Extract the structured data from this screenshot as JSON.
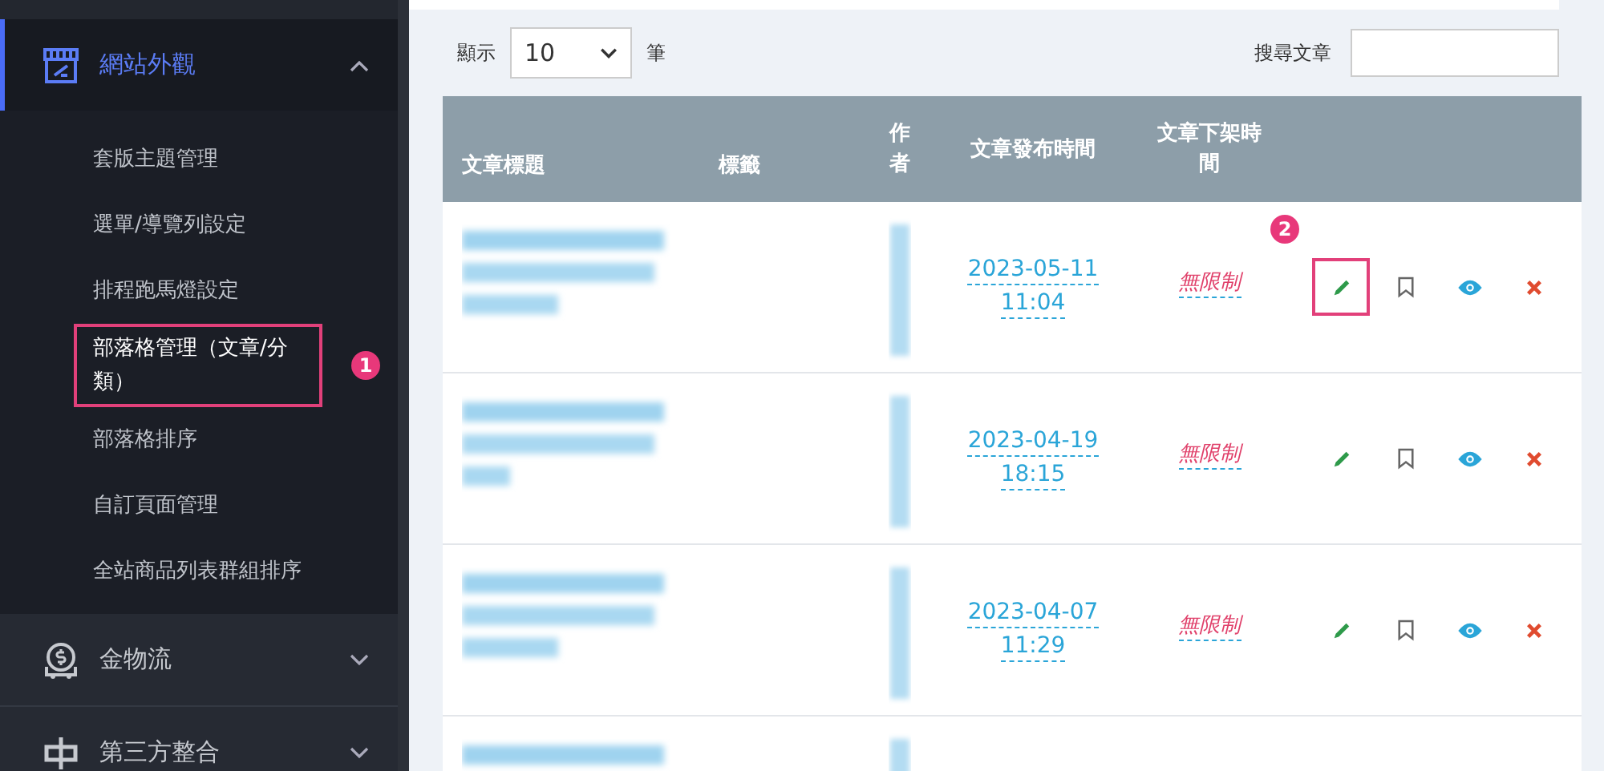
{
  "sidebar": {
    "sections": [
      {
        "label": "網站外觀",
        "expanded": true,
        "selected": true,
        "items": [
          {
            "label": "套版主題管理",
            "selected": false
          },
          {
            "label": "選單/導覽列設定",
            "selected": false
          },
          {
            "label": "排程跑馬燈設定",
            "selected": false
          },
          {
            "label": "部落格管理（文章/分類）",
            "selected": true,
            "callout": "1"
          },
          {
            "label": "部落格排序",
            "selected": false
          },
          {
            "label": "自訂頁面管理",
            "selected": false
          },
          {
            "label": "全站商品列表群組排序",
            "selected": false
          }
        ]
      },
      {
        "label": "金物流",
        "expanded": false,
        "selected": false
      },
      {
        "label": "第三方整合",
        "expanded": false,
        "selected": false
      }
    ]
  },
  "toolbar": {
    "show_label": "顯示",
    "page_size": "10",
    "unit_label": "筆",
    "search_label": "搜尋文章"
  },
  "table": {
    "columns": [
      "文章標題",
      "標籤",
      "作者",
      "文章發布時間",
      "文章下架時間"
    ],
    "rows": [
      {
        "published_date": "2023-05-11",
        "published_time": "11:04",
        "expiry": "無限制",
        "edit_callout": "2"
      },
      {
        "published_date": "2023-04-19",
        "published_time": "18:15",
        "expiry": "無限制"
      },
      {
        "published_date": "2023-04-07",
        "published_time": "11:29",
        "expiry": "無限制"
      },
      {}
    ]
  }
}
